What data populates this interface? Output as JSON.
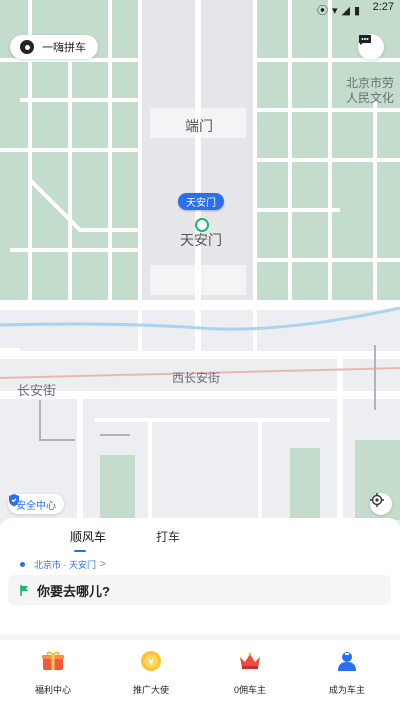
{
  "status_bar": {
    "time": "2:27"
  },
  "top_bar": {
    "carpool_label": "一嗨拼车"
  },
  "map": {
    "labels": {
      "duanmen": "端门",
      "tiananmen": "天安门",
      "changanjie": "长安街",
      "xichanganjie": "西长安街",
      "museum": "北京市劳 人民文化"
    },
    "location_pill": "天安门"
  },
  "safety_label": "安全中心",
  "tabs": [
    {
      "label": "顺风车"
    },
    {
      "label": "打车"
    }
  ],
  "origin": {
    "text": "北京市 · 天安门",
    "chevron": ">"
  },
  "destination": {
    "placeholder": "你要去哪儿?"
  },
  "bottom_nav": [
    {
      "label": "福利中心",
      "icon": "gift-icon"
    },
    {
      "label": "推广大使",
      "icon": "coin-icon"
    },
    {
      "label": "0佣车主",
      "icon": "crown-icon"
    },
    {
      "label": "成为车主",
      "icon": "driver-icon"
    }
  ],
  "colors": {
    "accent": "#2a6ff0",
    "green": "#19b86b",
    "park": "#bfd8c8"
  }
}
